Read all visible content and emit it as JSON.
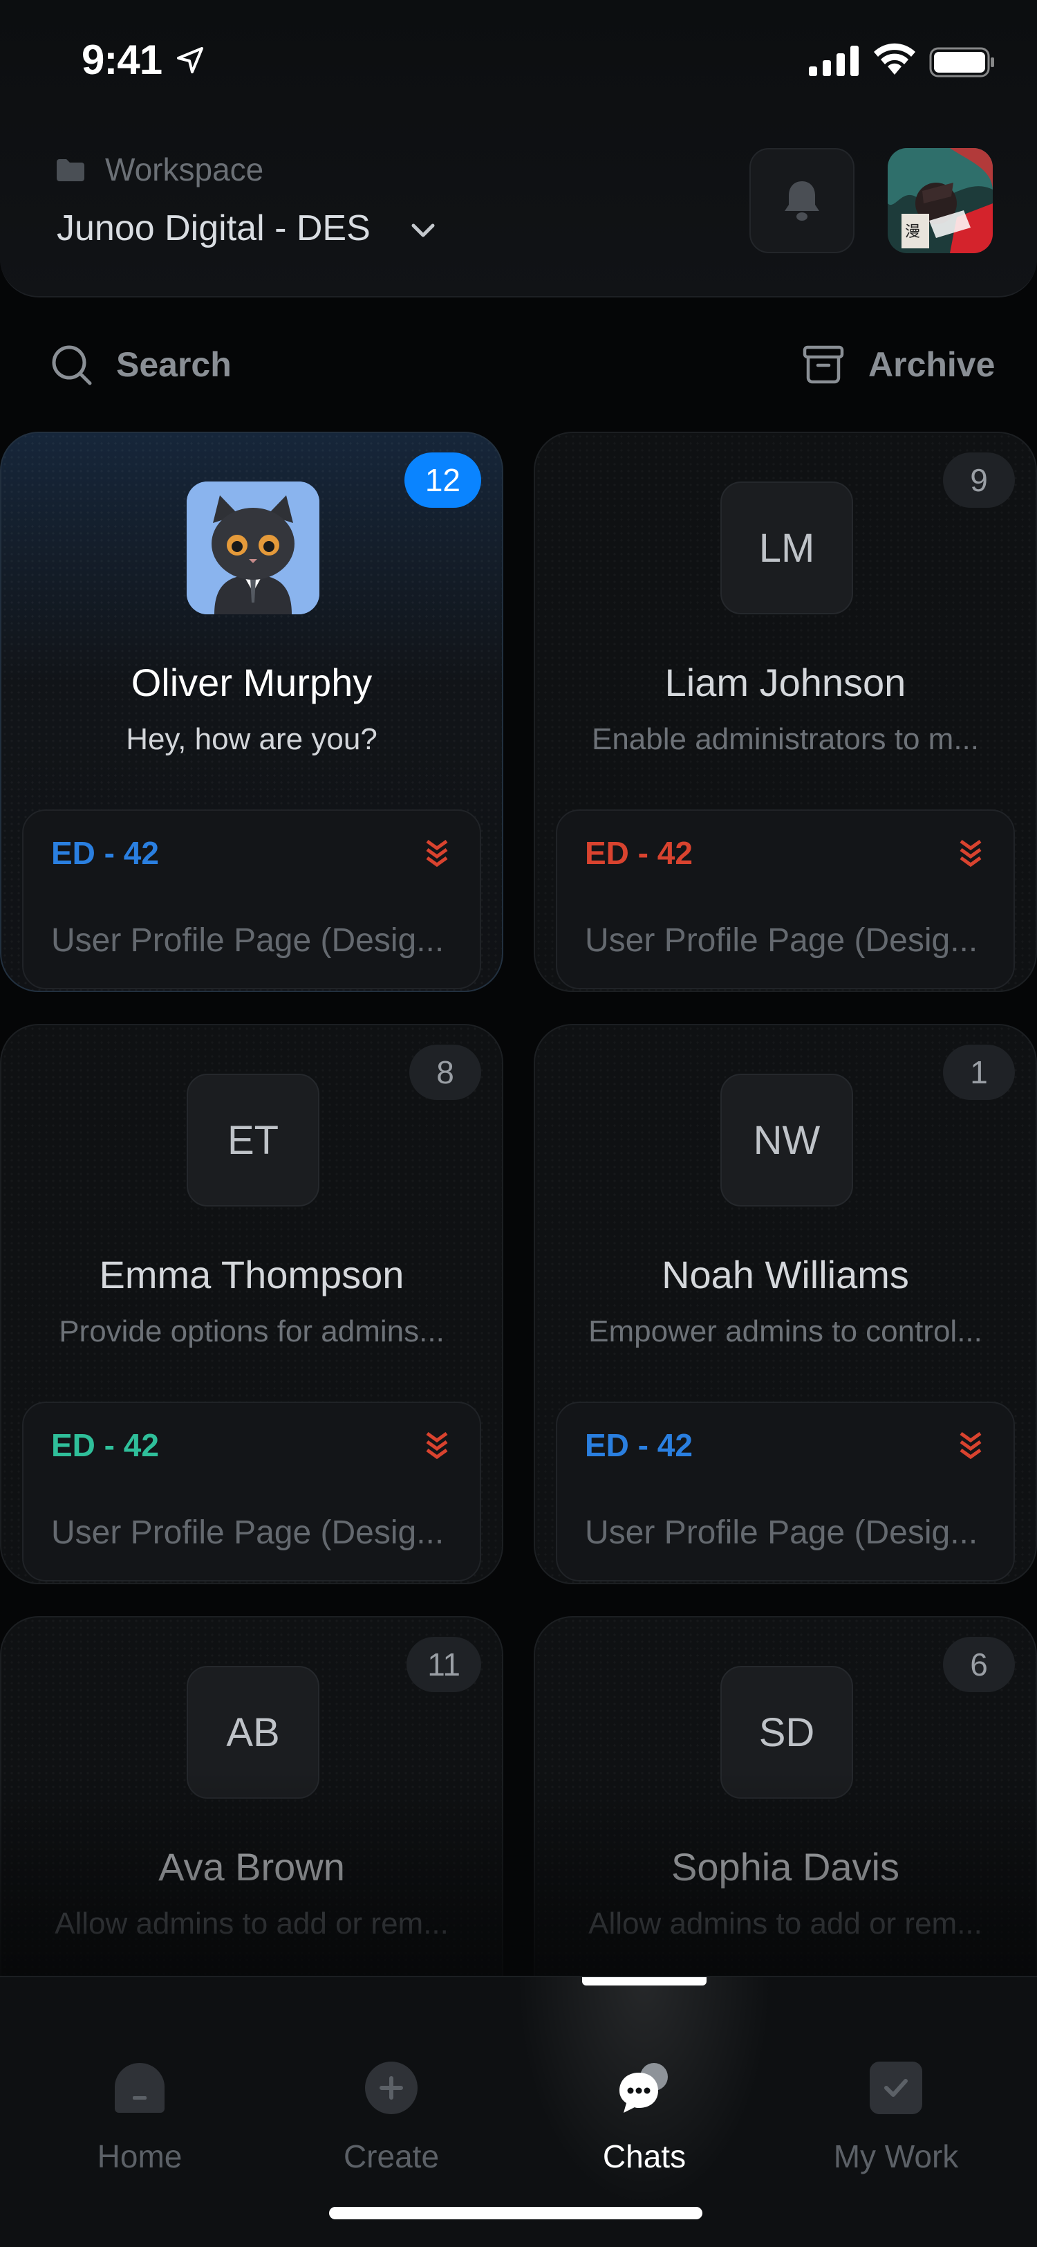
{
  "status_bar": {
    "time": "9:41"
  },
  "header": {
    "workspace_label": "Workspace",
    "workspace_name": "Junoo Digital - DES"
  },
  "search": {
    "label": "Search"
  },
  "archive": {
    "label": "Archive"
  },
  "chats": [
    {
      "name": "Oliver Murphy",
      "initials": "",
      "avatar": "cat-avatar",
      "message": "Hey, how are you?",
      "count": "12",
      "highlight": true,
      "task_id": "ED - 42",
      "task_color": "#2a7fe0",
      "task_title": "User Profile Page (Desig..."
    },
    {
      "name": "Liam Johnson",
      "initials": "LM",
      "message": "Enable administrators to m...",
      "count": "9",
      "task_id": "ED - 42",
      "task_color": "#d9432f",
      "task_title": "User Profile Page (Desig..."
    },
    {
      "name": "Emma Thompson",
      "initials": "ET",
      "message": "Provide options for admins...",
      "count": "8",
      "task_id": "ED - 42",
      "task_color": "#2fbf9a",
      "task_title": "User Profile Page (Desig..."
    },
    {
      "name": "Noah Williams",
      "initials": "NW",
      "message": "Empower admins to control...",
      "count": "1",
      "task_id": "ED - 42",
      "task_color": "#2a7fe0",
      "task_title": "User Profile Page (Desig..."
    },
    {
      "name": "Ava Brown",
      "initials": "AB",
      "message": "Allow admins to add or rem...",
      "count": "11"
    },
    {
      "name": "Sophia Davis",
      "initials": "SD",
      "message": "Allow admins to add or rem...",
      "count": "6"
    }
  ],
  "colors": {
    "accent": "#0a84ff",
    "priority": "#d9432f"
  },
  "tabs": [
    {
      "label": "Home",
      "icon": "home-icon"
    },
    {
      "label": "Create",
      "icon": "plus-icon"
    },
    {
      "label": "Chats",
      "icon": "chat-bubbles-icon",
      "active": true
    },
    {
      "label": "My Work",
      "icon": "checkbox-icon"
    }
  ]
}
